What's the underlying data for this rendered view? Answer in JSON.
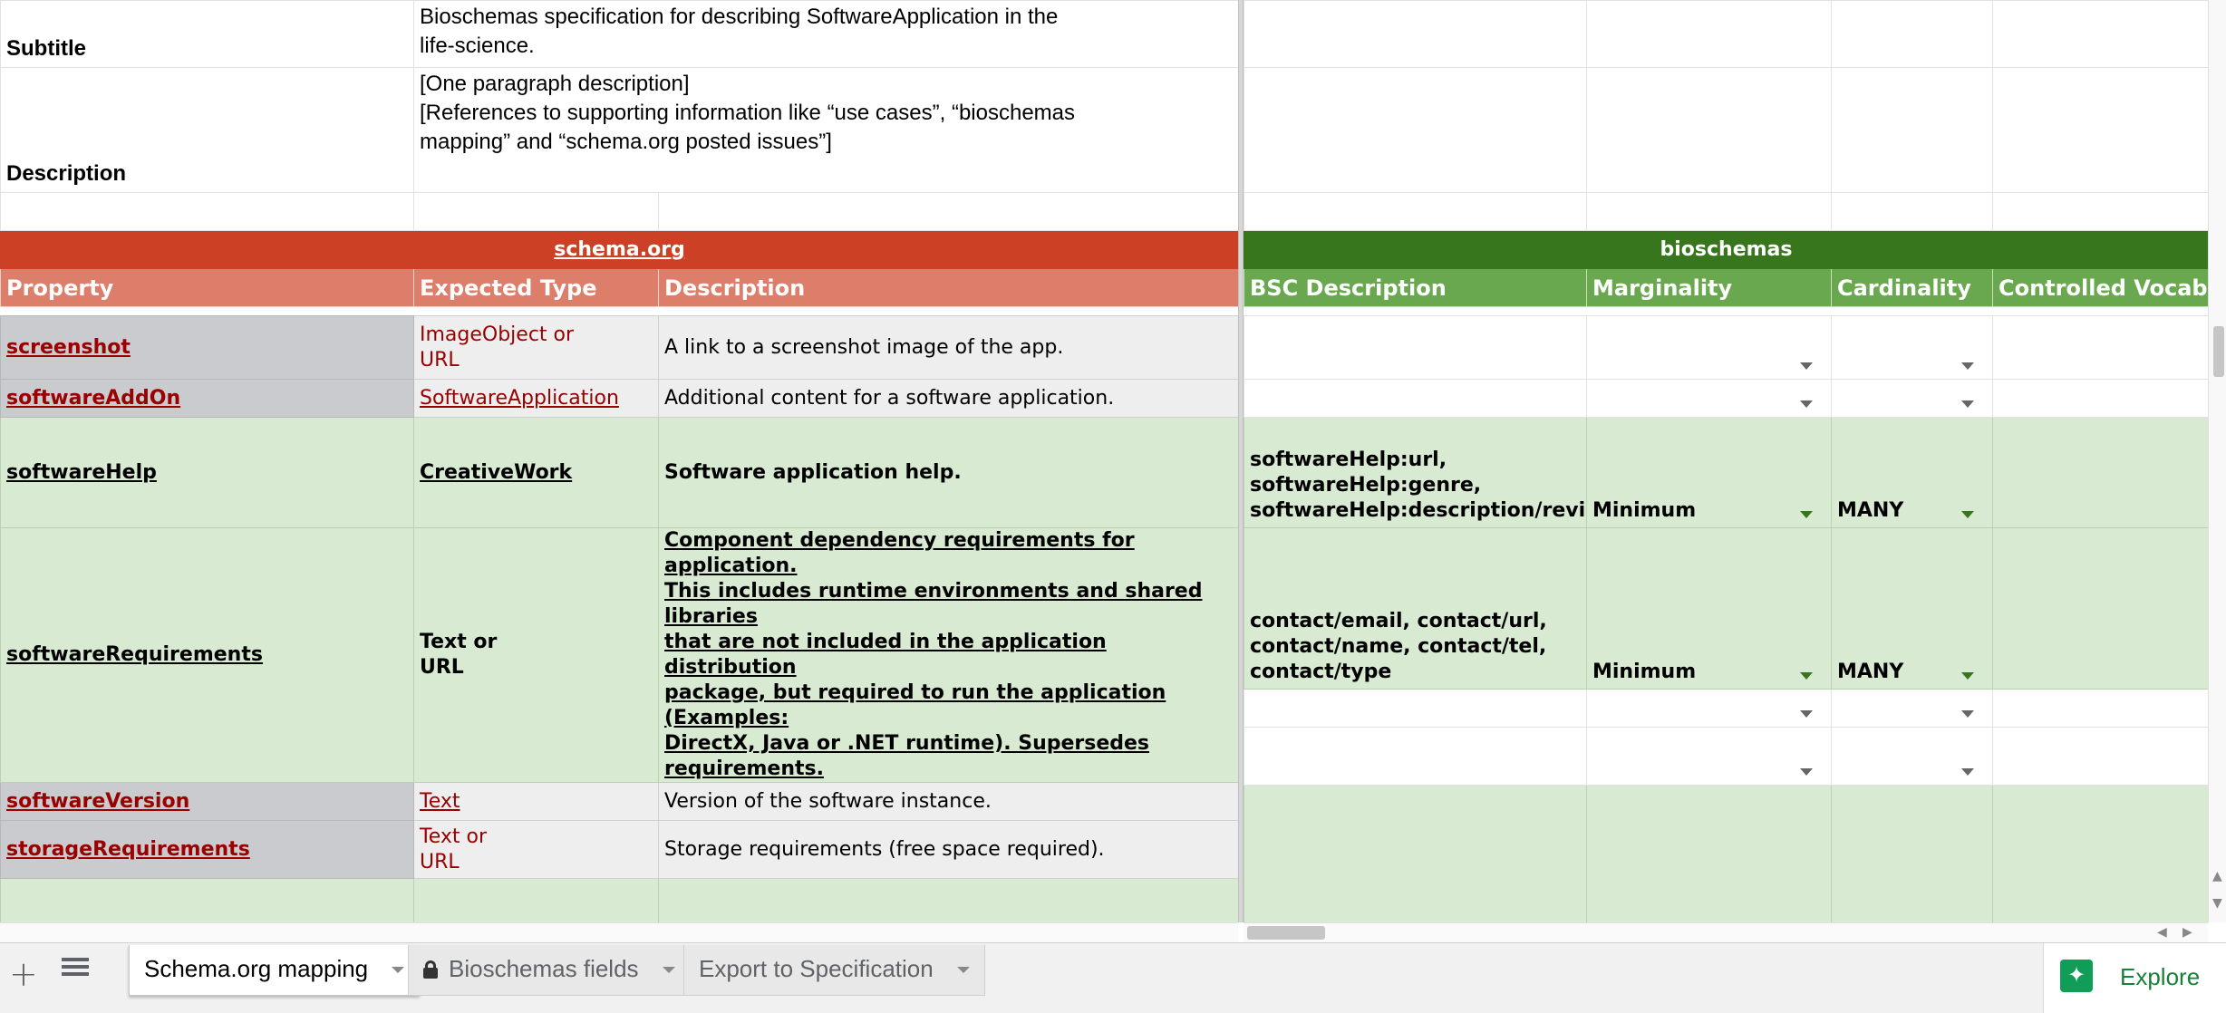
{
  "meta_rows": {
    "subtitle_label": "Subtitle",
    "subtitle_value_line1": "Bioschemas specification for describing SoftwareApplication in the",
    "subtitle_value_line2": "life-science.",
    "description_label": "Description",
    "description_line1": "[One paragraph description]",
    "description_line2": "[References to supporting information like “use cases”, “bioschemas",
    "description_line3": "mapping” and “schema.org posted issues”]"
  },
  "bands": {
    "schema_org": "schema.org",
    "bioschemas": "bioschemas"
  },
  "columns": {
    "property": "Property",
    "expected_type": "Expected Type",
    "description": "Description",
    "bsc_description": "BSC Description",
    "marginality": "Marginality",
    "cardinality": "Cardinality",
    "controlled_vocabulary": "Controlled Vocabu"
  },
  "rows": [
    {
      "property": "screenshot",
      "type_line1": "ImageObject or",
      "type_line2": "URL",
      "description": "A link to a screenshot image of the app."
    },
    {
      "property": "softwareAddOn",
      "type_line1": "SoftwareApplication",
      "description": "Additional content for a software application."
    },
    {
      "property": "softwareHelp",
      "type_line1": "CreativeWork",
      "description": "Software application help.",
      "bsc_line1": "softwareHelp:url,",
      "bsc_line2": "softwareHelp:genre,",
      "bsc_line3": "softwareHelp:description/review",
      "marginality": "Minimum",
      "cardinality": "MANY"
    },
    {
      "property": "softwareRequirements",
      "type_line1": "Text or",
      "type_line2": "URL",
      "desc_line1": "Component dependency requirements for application.",
      "desc_line2": "This includes runtime environments and shared libraries",
      "desc_line3": "that are not included in the application distribution",
      "desc_line4": "package, but required to run the application (Examples:",
      "desc_line5": "DirectX, Java or .NET runtime). Supersedes",
      "desc_line6": "requirements.",
      "bsc_line1": "contact/email, contact/url,",
      "bsc_line2": "contact/name, contact/tel,",
      "bsc_line3": "contact/type",
      "marginality": "Minimum",
      "cardinality": "MANY"
    },
    {
      "property": "softwareVersion",
      "type_line1": "Text",
      "description": "Version of the software instance."
    },
    {
      "property": "storageRequirements",
      "type_line1": "Text or",
      "type_line2": "URL",
      "description": "Storage requirements (free space required)."
    }
  ],
  "tabs": [
    {
      "label": "Schema.org mapping",
      "active": true
    },
    {
      "label": "Bioschemas fields",
      "locked": true
    },
    {
      "label": "Export to Specification"
    }
  ],
  "explore_label": "Explore",
  "colors": {
    "schema_band": "#cc4125",
    "schema_header": "#dd7e6b",
    "bio_band": "#38761d",
    "bio_header": "#6aa84f",
    "green_row": "#d9ead3",
    "link_red": "#990000"
  }
}
